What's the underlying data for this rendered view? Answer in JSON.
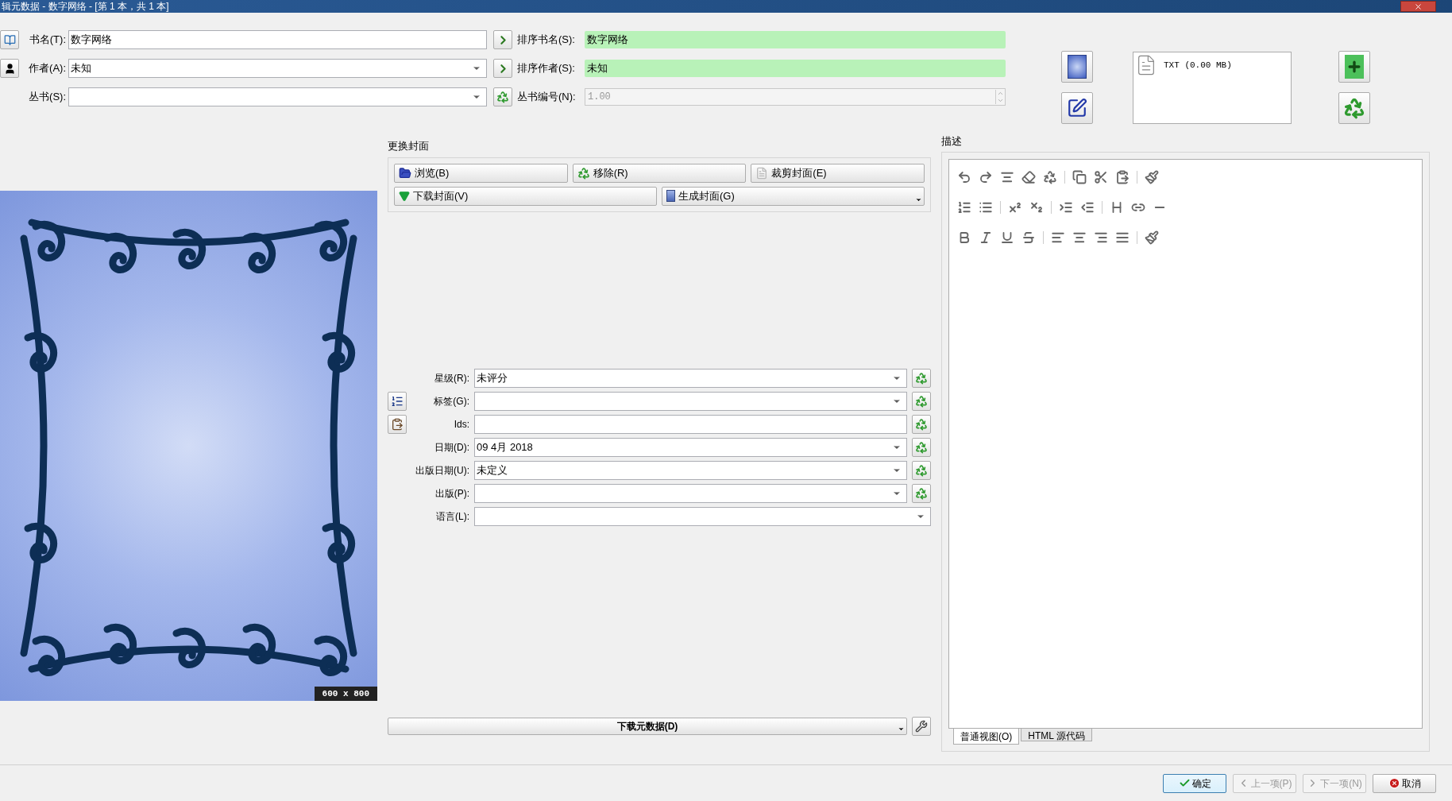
{
  "window": {
    "title": "辑元数据 - 数字网络 - [第 1 本，共 1 本]"
  },
  "basic": [
    {
      "label": "书名(T):",
      "value": "数字网络",
      "kind": "text",
      "sort_label": "排序书名(S):",
      "sort_value": "数字网络"
    },
    {
      "label": "作者(A):",
      "value": "未知",
      "kind": "combo",
      "sort_label": "排序作者(S):",
      "sort_value": "未知"
    },
    {
      "label": "丛书(S):",
      "kind": "combo",
      "sort_label": "丛书编号(N):",
      "sort_value": "1.00"
    }
  ],
  "formats": [
    {
      "label": "TXT (0.00 MB)"
    }
  ],
  "cover": {
    "size": "600 x 800"
  },
  "change_cover": {
    "title": "更换封面",
    "buttons": [
      {
        "label": "浏览(B)"
      },
      {
        "label": "移除(R)"
      },
      {
        "label": "裁剪封面(E)"
      },
      {
        "label": "下载封面(V)"
      },
      {
        "label": "生成封面(G)"
      }
    ]
  },
  "fields": [
    {
      "label": "星级(R):",
      "value": "未评分",
      "kind": "combo"
    },
    {
      "label": "标签(G):",
      "kind": "combo"
    },
    {
      "label": "Ids:",
      "kind": "text"
    },
    {
      "label": "日期(D):",
      "value": "09 4月 2018",
      "kind": "combo"
    },
    {
      "label": "出版日期(U):",
      "value": "未定义",
      "kind": "combo"
    },
    {
      "label": "出版(P):",
      "kind": "combo"
    },
    {
      "label": "语言(L):",
      "kind": "combo"
    }
  ],
  "download_button": "下载元数据(D)",
  "description": {
    "title": "描述",
    "tabs": [
      {
        "label": "普通视图(O)",
        "selected": true
      },
      {
        "label": "HTML 源代码",
        "selected": false
      }
    ]
  },
  "footer_buttons": [
    {
      "label": "确定",
      "kind": "ok",
      "disabled": false
    },
    {
      "label": "上一项(P)",
      "kind": "prev",
      "disabled": true
    },
    {
      "label": "下一项(N)",
      "kind": "next",
      "disabled": true
    },
    {
      "label": "取消",
      "kind": "cancel",
      "disabled": false
    }
  ]
}
